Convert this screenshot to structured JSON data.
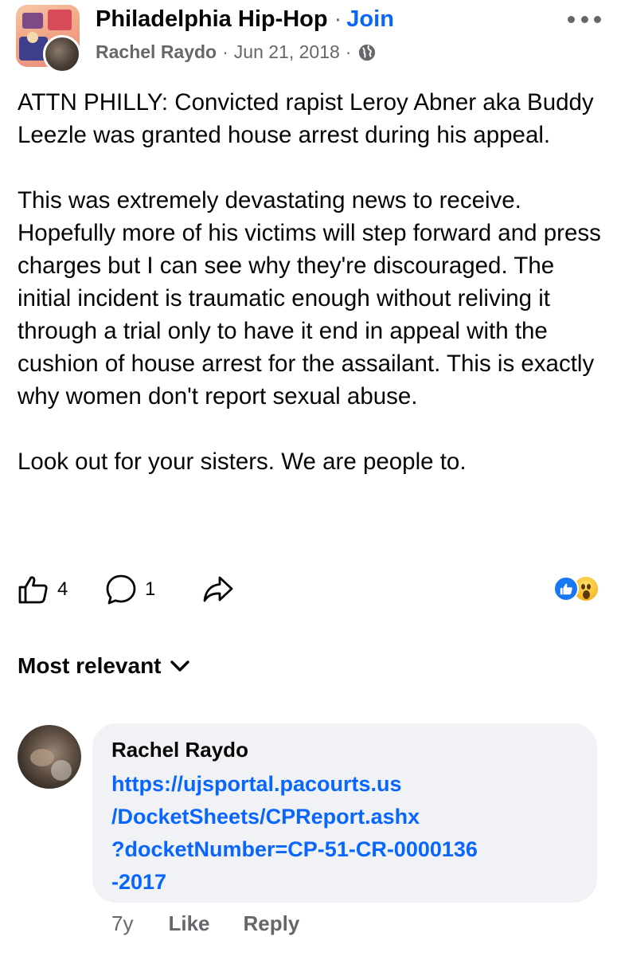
{
  "header": {
    "group_name": "Philadelphia Hip-Hop",
    "separator": "·",
    "join_label": "Join",
    "author": "Rachel Raydo",
    "date": "Jun 21, 2018",
    "privacy_icon": "globe-icon",
    "more_icon": "more-horizontal-icon"
  },
  "post": {
    "paragraphs": [
      "ATTN PHILLY: Convicted rapist Leroy Abner aka Buddy Leezle was granted house arrest during his appeal.",
      "This was extremely devastating news to receive. Hopefully more of his victims will step forward and press charges but I can see why they're discouraged. The initial incident is traumatic enough without reliving it through a trial only to have it end in appeal with the cushion of house arrest for the assailant. This is exactly why women don't report sexual abuse.",
      "Look out for your sisters. We are people to."
    ]
  },
  "actions": {
    "like_count": "4",
    "comment_count": "1",
    "icons": [
      "thumbs-up-icon",
      "comment-icon",
      "share-icon"
    ],
    "reactions": [
      "like-reaction-icon",
      "wow-reaction-icon"
    ]
  },
  "comments": {
    "sort_label": "Most relevant",
    "items": [
      {
        "author": "Rachel Raydo",
        "link_lines": [
          "https://ujsportal.pacourts.us",
          "/DocketSheets/CPReport.ashx",
          "?docketNumber=CP-51-CR-0000136",
          "-2017"
        ],
        "age": "7y",
        "like_label": "Like",
        "reply_label": "Reply"
      }
    ]
  },
  "colors": {
    "accent": "#0866ff",
    "secondary_text": "#65676b",
    "bubble": "#f0f2f5"
  }
}
